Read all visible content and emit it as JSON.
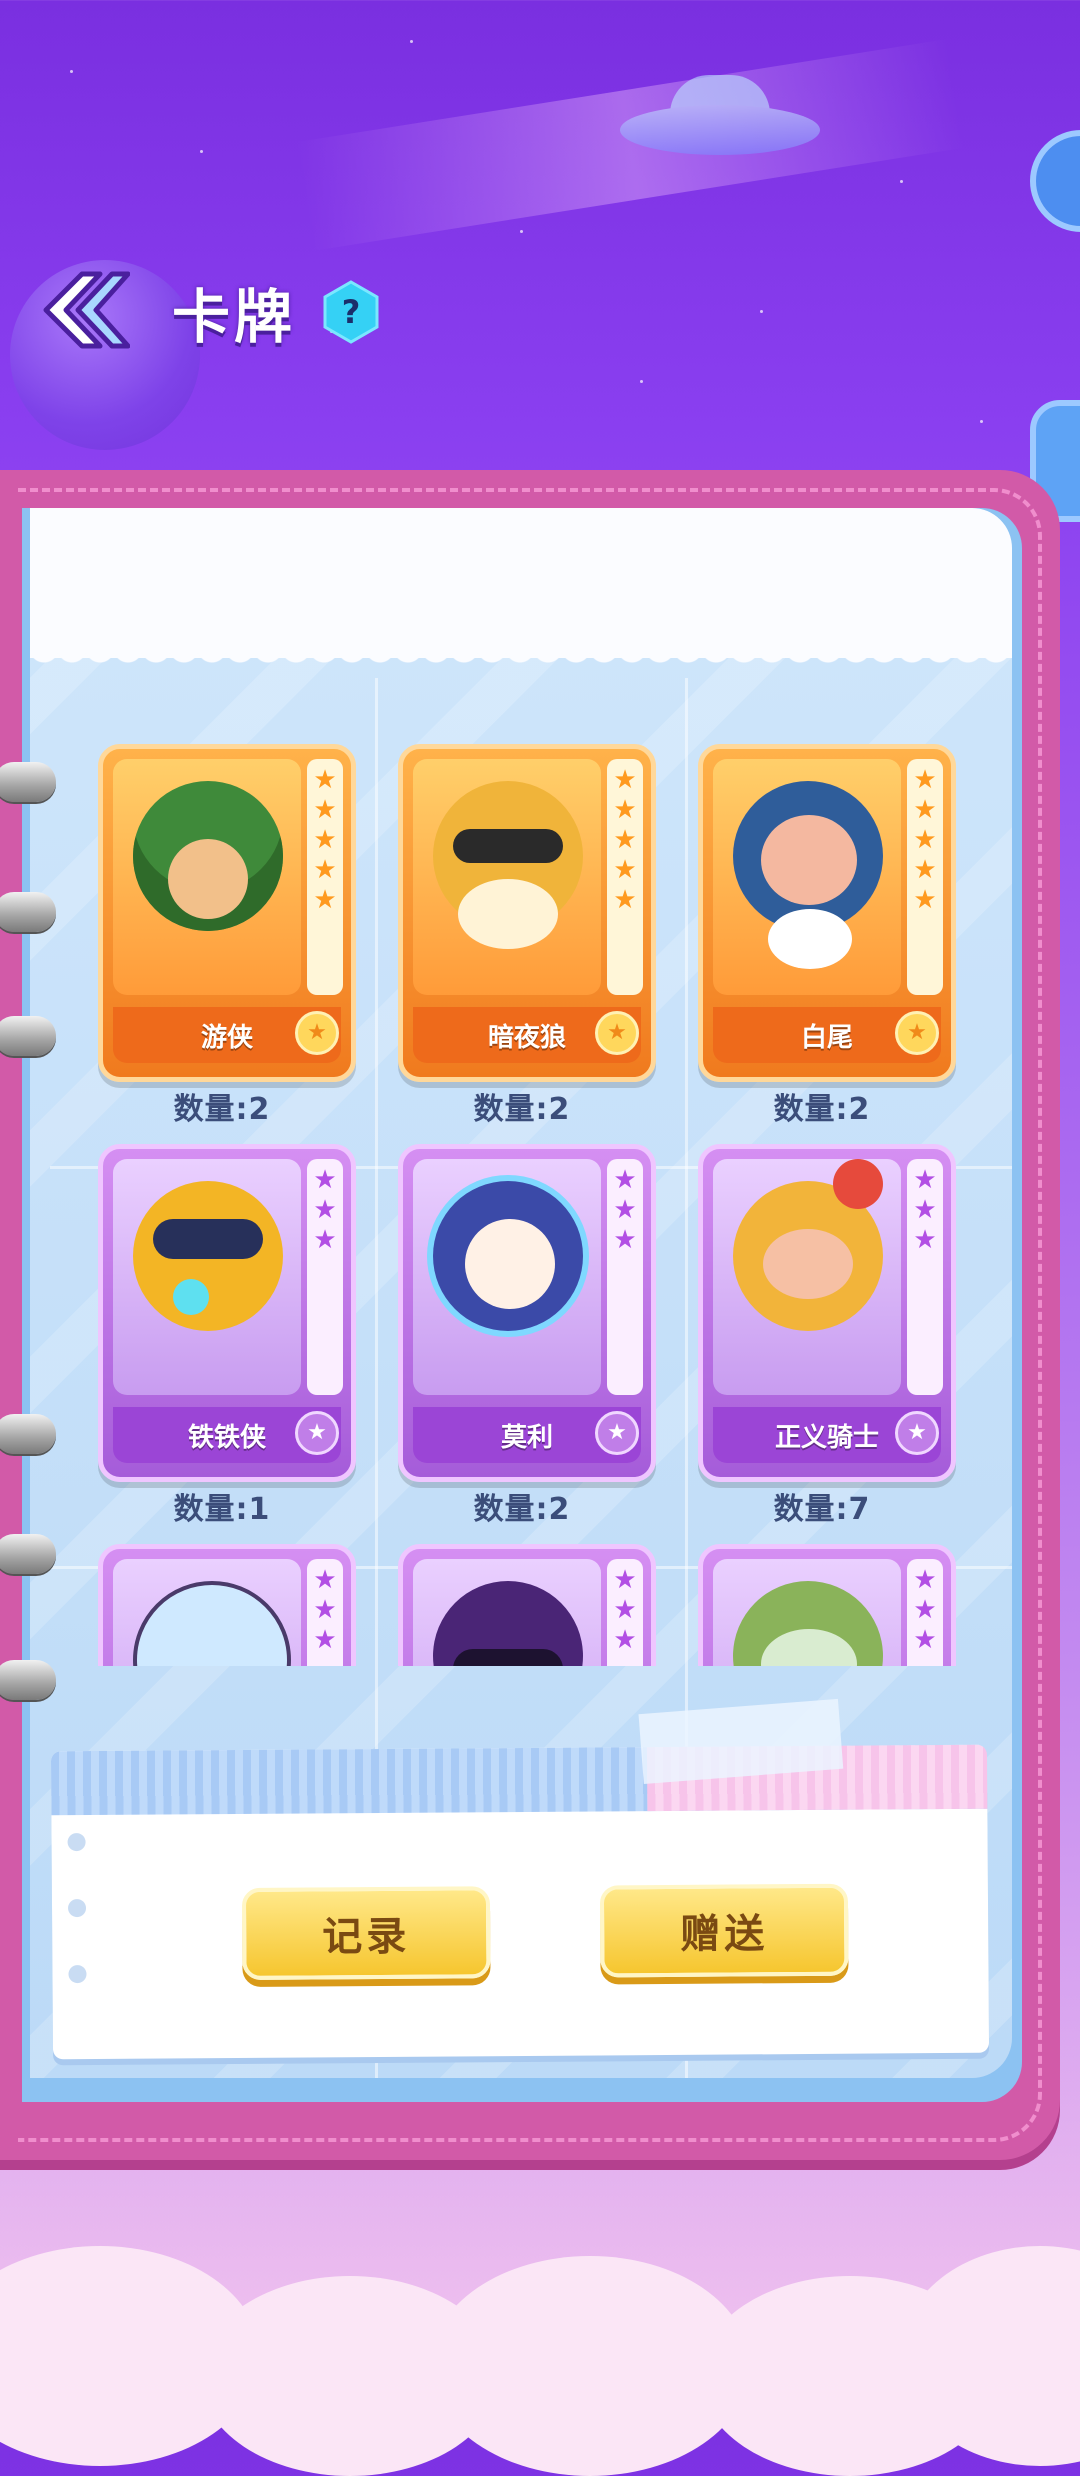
{
  "header": {
    "title": "卡牌",
    "help_label": "?"
  },
  "cards": [
    {
      "name": "游侠",
      "rarity": "orange",
      "stars": 5,
      "quantity": "数量:2"
    },
    {
      "name": "暗夜狼",
      "rarity": "orange",
      "stars": 5,
      "quantity": "数量:2"
    },
    {
      "name": "白尾",
      "rarity": "orange",
      "stars": 5,
      "quantity": "数量:2"
    },
    {
      "name": "铁铁侠",
      "rarity": "purple",
      "stars": 3,
      "quantity": "数量:1"
    },
    {
      "name": "莫利",
      "rarity": "purple",
      "stars": 3,
      "quantity": "数量:2"
    },
    {
      "name": "正义骑士",
      "rarity": "purple",
      "stars": 3,
      "quantity": "数量:7"
    },
    {
      "name": "",
      "rarity": "purple",
      "stars": 3,
      "quantity": ""
    },
    {
      "name": "",
      "rarity": "purple",
      "stars": 3,
      "quantity": ""
    },
    {
      "name": "",
      "rarity": "purple",
      "stars": 3,
      "quantity": ""
    }
  ],
  "actions": {
    "record_label": "记录",
    "gift_label": "赠送"
  },
  "colors": {
    "background_top": "#7a2fe0",
    "notebook_cover": "#d25aa8",
    "card_orange": "#f07a1e",
    "card_purple": "#a55cd9",
    "button_yellow": "#f6c62f"
  }
}
